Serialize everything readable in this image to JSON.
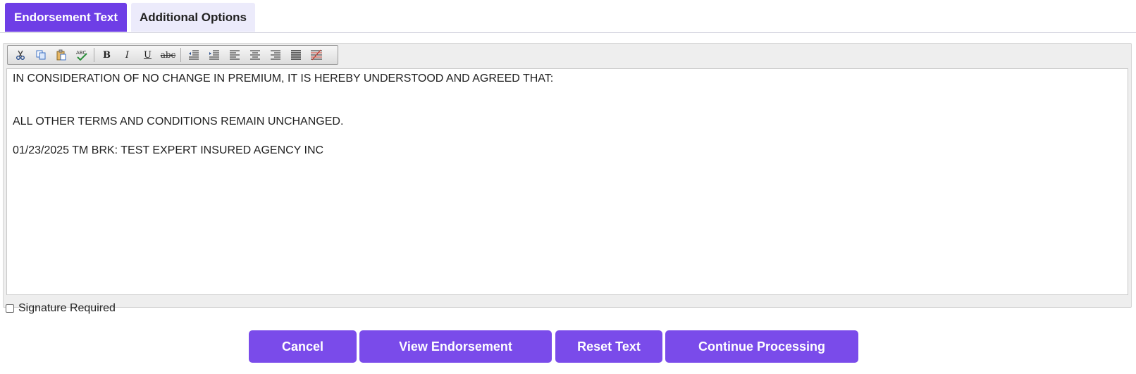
{
  "tabs": [
    {
      "label": "Endorsement Text",
      "active": true
    },
    {
      "label": "Additional Options",
      "active": false
    }
  ],
  "toolbar": {
    "buttons": [
      "cut-icon",
      "copy-icon",
      "paste-icon",
      "spellcheck-icon",
      "bold-icon",
      "italic-icon",
      "underline-icon",
      "strikethrough-icon",
      "outdent-icon",
      "indent-icon",
      "align-left-icon",
      "align-center-icon",
      "align-right-icon",
      "justify-icon",
      "insert-table-icon"
    ],
    "bold_glyph": "B",
    "italic_glyph": "I",
    "underline_glyph": "U",
    "strike_glyph": "abc"
  },
  "editor": {
    "lines": [
      "IN CONSIDERATION OF NO CHANGE IN PREMIUM, IT IS HEREBY UNDERSTOOD AND AGREED THAT:",
      "",
      "",
      "ALL OTHER TERMS AND CONDITIONS REMAIN UNCHANGED.",
      "",
      "01/23/2025 TM BRK: TEST EXPERT INSURED AGENCY INC"
    ]
  },
  "signature": {
    "label": "Signature Required",
    "checked": false
  },
  "actions": {
    "cancel": "Cancel",
    "view": "View Endorsement",
    "reset": "Reset Text",
    "continue": "Continue Processing"
  },
  "colors": {
    "accent": "#6e3ee6",
    "button": "#7a4bea",
    "tab_inactive": "#ecebfb"
  }
}
